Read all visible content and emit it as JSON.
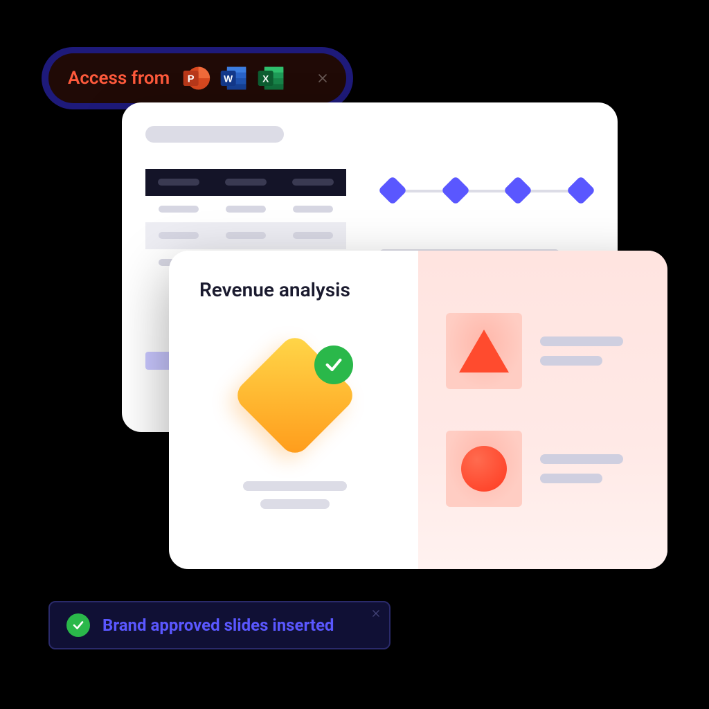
{
  "access_toast": {
    "label": "Access from",
    "apps": [
      "powerpoint",
      "word",
      "excel"
    ]
  },
  "slide": {
    "title": "Revenue analysis"
  },
  "bottom_toast": {
    "message": "Brand approved slides inserted"
  },
  "colors": {
    "accent_orange": "#ff5a3c",
    "accent_indigo": "#5a57ff",
    "success": "#2ab84a"
  }
}
